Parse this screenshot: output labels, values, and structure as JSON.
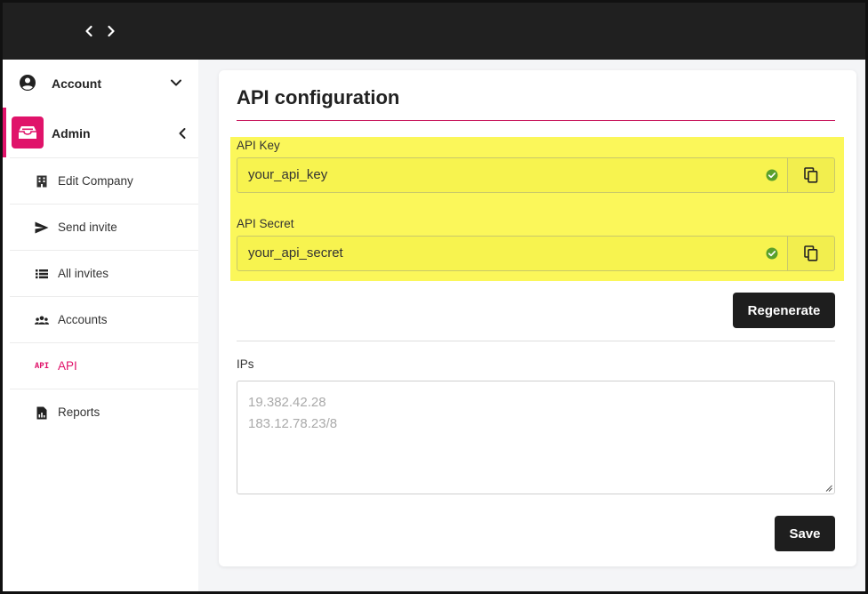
{
  "topbar": {
    "back_icon": "chevron-left-icon",
    "forward_icon": "chevron-right-icon"
  },
  "sidebar": {
    "account": {
      "label": "Account",
      "icon": "account-circle-icon",
      "chevron": "chevron-down-icon"
    },
    "admin": {
      "label": "Admin",
      "icon": "admin-badge-icon",
      "chevron": "chevron-left-icon",
      "accent": "#e0136a"
    },
    "items": [
      {
        "label": "Edit Company",
        "icon": "building-icon"
      },
      {
        "label": "Send invite",
        "icon": "send-icon"
      },
      {
        "label": "All invites",
        "icon": "list-icon"
      },
      {
        "label": "Accounts",
        "icon": "group-icon"
      },
      {
        "label": "API",
        "icon": "api-icon",
        "icon_text": "API",
        "active": true
      },
      {
        "label": "Reports",
        "icon": "report-icon"
      }
    ]
  },
  "card": {
    "title": "API configuration",
    "api_key": {
      "label": "API Key",
      "value": "your_api_key"
    },
    "api_secret": {
      "label": "API Secret",
      "value": "your_api_secret"
    },
    "regenerate_label": "Regenerate",
    "ips": {
      "label": "IPs",
      "lines": [
        "19.382.42.28",
        "183.12.78.23/8"
      ]
    },
    "save_label": "Save"
  },
  "colors": {
    "accent": "#e0136a",
    "highlight": "#fbf75a",
    "topbar": "#202020",
    "button": "#1e1e1e",
    "check": "#5aa02c"
  }
}
